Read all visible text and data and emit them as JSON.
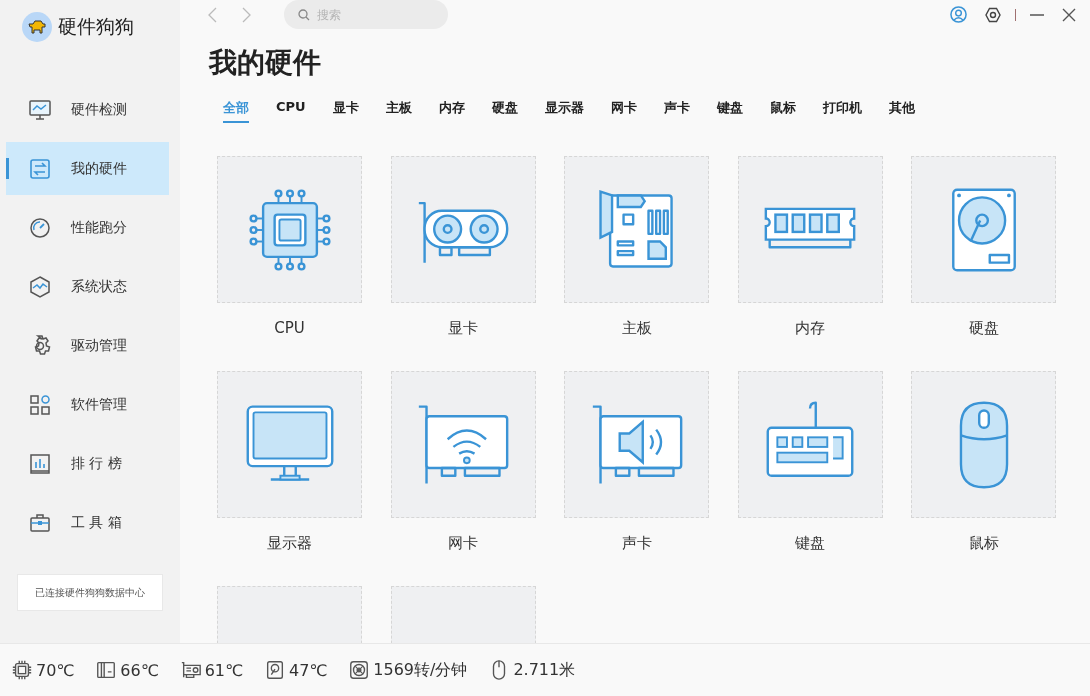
{
  "app": {
    "title": "硬件狗狗"
  },
  "sidebar": {
    "items": [
      {
        "label": "硬件检测",
        "kind": "monitor",
        "selected": false
      },
      {
        "label": "我的硬件",
        "kind": "swap",
        "selected": true
      },
      {
        "label": "性能跑分",
        "kind": "gauge",
        "selected": false
      },
      {
        "label": "系统状态",
        "kind": "pulse",
        "selected": false
      },
      {
        "label": "驱动管理",
        "kind": "gear",
        "selected": false
      },
      {
        "label": "软件管理",
        "kind": "apps",
        "selected": false
      },
      {
        "label": "排 行 榜",
        "kind": "chart",
        "selected": false
      },
      {
        "label": "工 具 箱",
        "kind": "toolbox",
        "selected": false
      }
    ],
    "connection": "已连接硬件狗狗数据中心"
  },
  "search": {
    "placeholder": "搜索"
  },
  "page_title": "我的硬件",
  "tabs": [
    {
      "label": "全部",
      "selected": true
    },
    {
      "label": "CPU",
      "selected": false
    },
    {
      "label": "显卡",
      "selected": false
    },
    {
      "label": "主板",
      "selected": false
    },
    {
      "label": "内存",
      "selected": false
    },
    {
      "label": "硬盘",
      "selected": false
    },
    {
      "label": "显示器",
      "selected": false
    },
    {
      "label": "网卡",
      "selected": false
    },
    {
      "label": "声卡",
      "selected": false
    },
    {
      "label": "键盘",
      "selected": false
    },
    {
      "label": "鼠标",
      "selected": false
    },
    {
      "label": "打印机",
      "selected": false
    },
    {
      "label": "其他",
      "selected": false
    }
  ],
  "cards": [
    {
      "label": "CPU",
      "kind": "cpu"
    },
    {
      "label": "显卡",
      "kind": "gpu"
    },
    {
      "label": "主板",
      "kind": "board"
    },
    {
      "label": "内存",
      "kind": "ram"
    },
    {
      "label": "硬盘",
      "kind": "disk"
    },
    {
      "label": "显示器",
      "kind": "screen"
    },
    {
      "label": "网卡",
      "kind": "nic"
    },
    {
      "label": "声卡",
      "kind": "sound"
    },
    {
      "label": "键盘",
      "kind": "keyboard"
    },
    {
      "label": "鼠标",
      "kind": "mouse"
    },
    {
      "kind": "cut"
    },
    {
      "kind": "cut"
    }
  ],
  "status_bar": [
    {
      "kind": "chip",
      "text": "70℃"
    },
    {
      "kind": "board",
      "text": "66℃"
    },
    {
      "kind": "gpu",
      "text": "61℃"
    },
    {
      "kind": "disk",
      "text": "47℃"
    },
    {
      "kind": "fan",
      "text": "1569转/分钟"
    },
    {
      "kind": "mouse",
      "text": "2.711米"
    }
  ]
}
